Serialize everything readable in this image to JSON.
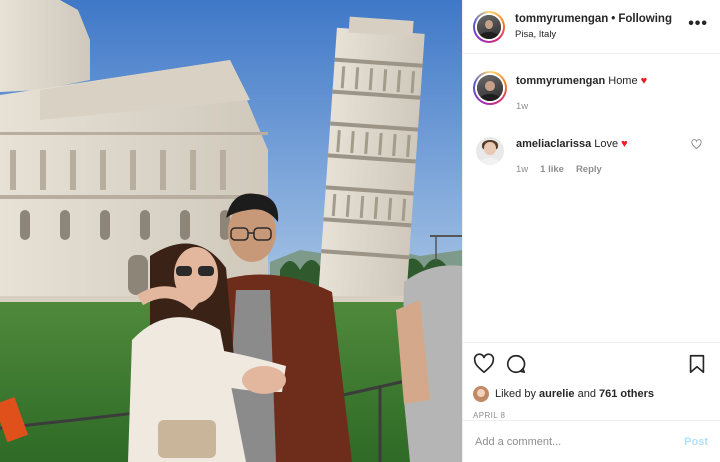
{
  "header": {
    "username": "tommyrumengan",
    "separator": "•",
    "follow_state": "Following",
    "location": "Pisa, Italy",
    "more_icon": "more-horizontal-icon",
    "more_glyph": "•••"
  },
  "comments": [
    {
      "username": "tommyrumengan",
      "text": "Home",
      "emoji": "♥",
      "age": "1w"
    },
    {
      "username": "ameliaclarissa",
      "text": "Love",
      "emoji": "♥",
      "age": "1w",
      "likes": "1 like",
      "reply": "Reply"
    }
  ],
  "actions": {
    "like_icon": "heart-icon",
    "comment_icon": "comment-icon",
    "save_icon": "bookmark-icon"
  },
  "likes": {
    "prefix": "Liked by",
    "user": "aurelie",
    "conj": "and",
    "others": "761 others"
  },
  "date": "APRIL 8",
  "add_comment": {
    "placeholder": "Add a comment...",
    "post_label": "Post"
  },
  "colors": {
    "heart": "#ed1c24",
    "post_disabled": "#b2dffc",
    "meta": "#8e8e8e",
    "sky": "#5b8ed0"
  }
}
